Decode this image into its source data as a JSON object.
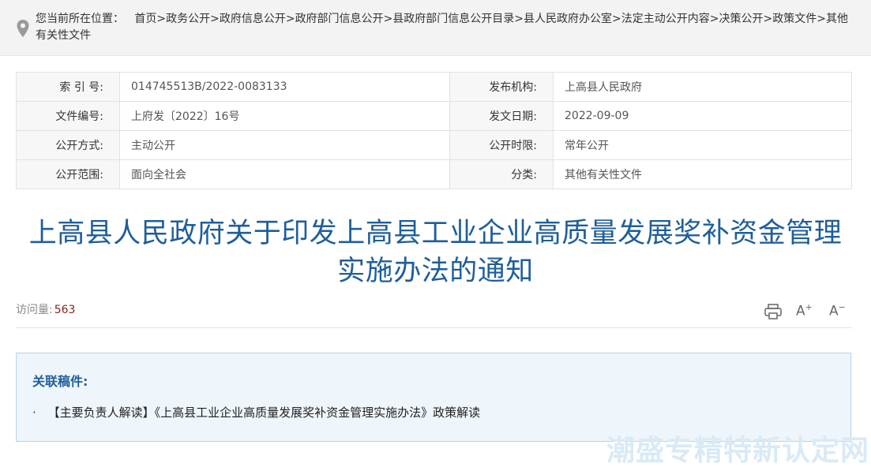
{
  "breadcrumb": {
    "prefix": "您当前所在位置：",
    "items": [
      "首页",
      "政务公开",
      "政府信息公开",
      "政府部门信息公开",
      "县政府部门信息公开目录",
      "县人民政府办公室",
      "法定主动公开内容",
      "决策公开",
      "政策文件",
      "其他有关性文件"
    ],
    "separator": ">"
  },
  "meta": {
    "rows": [
      {
        "l1": "索  引  号:",
        "v1": "014745513B/2022-0083133",
        "l2": "发布机构:",
        "v2": "上高县人民政府"
      },
      {
        "l1": "文件编号:",
        "v1": "上府发〔2022〕16号",
        "l2": "发文日期:",
        "v2": "2022-09-09"
      },
      {
        "l1": "公开方式:",
        "v1": "主动公开",
        "l2": "公开时限:",
        "v2": "常年公开"
      },
      {
        "l1": "公开范围:",
        "v1": "面向全社会",
        "l2": "分类:",
        "v2": "其他有关性文件"
      }
    ]
  },
  "article": {
    "title_line1": "上高县人民政府关于印发上高县工业企业高质量发展奖补资金管理",
    "title_line2": "实施办法的通知",
    "visits_label": "访问量:",
    "visits_count": "563"
  },
  "tools": {
    "print_icon": "printer-icon",
    "font_increase": "A",
    "font_decrease": "A"
  },
  "related": {
    "title": "关联稿件:",
    "items": [
      "【主要负责人解读】《上高县工业企业高质量发展奖补资金管理实施办法》政策解读"
    ]
  },
  "watermark": "潮盛专精特新认定网",
  "colors": {
    "title": "#1f5e9a",
    "visits_count": "#8b2020",
    "related_bg": "#eef5fb",
    "related_border": "#b9d3ea"
  }
}
